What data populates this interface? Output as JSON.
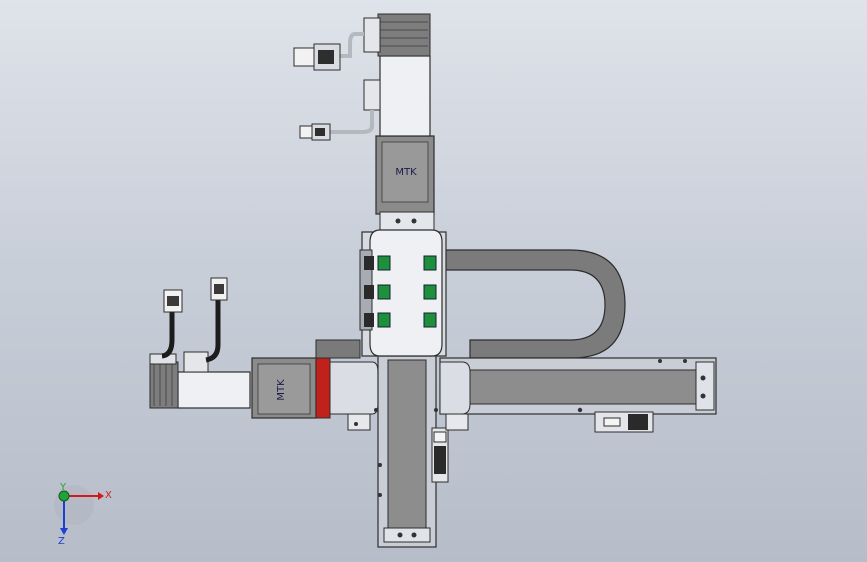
{
  "model": {
    "vertical_motor_label": "MTK",
    "horizontal_motor_label": "MTK"
  },
  "triad": {
    "x_label": "X",
    "y_label": "Y",
    "z_label": "Z"
  },
  "colors": {
    "background_top": "#dfe3ea",
    "background_bottom": "#b6bdc9",
    "body_gray": "#8a8a8a",
    "aluminum": "#c8ccd3",
    "motor_white": "#eef0f4",
    "accent_red": "#c0211b",
    "guide_green": "#1e8f3a",
    "cable_gray": "#6f6f6f",
    "x_axis": "#d11b1b",
    "y_axis": "#1fa33a",
    "z_axis": "#1b3fd1"
  }
}
